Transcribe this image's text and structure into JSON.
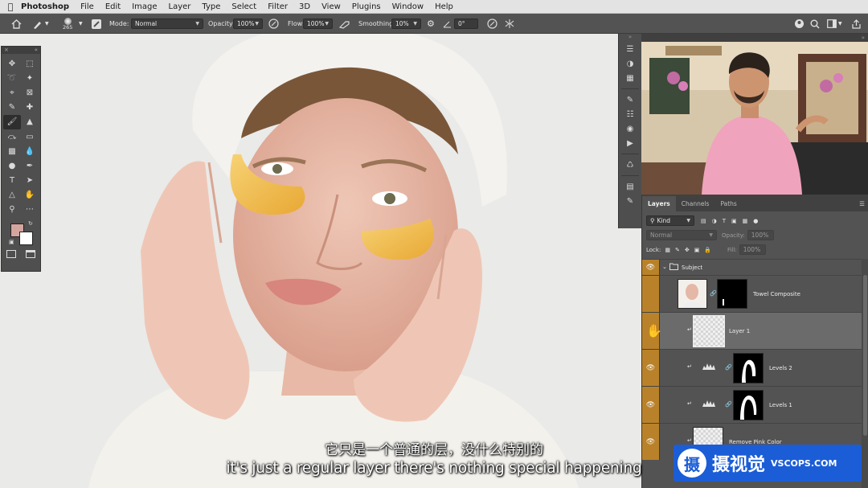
{
  "menubar": {
    "app_name": "Photoshop",
    "items": [
      "File",
      "Edit",
      "Image",
      "Layer",
      "Type",
      "Select",
      "Filter",
      "3D",
      "View",
      "Plugins",
      "Window",
      "Help"
    ]
  },
  "options_bar": {
    "brush_size": "265",
    "mode_label": "Mode:",
    "mode_value": "Normal",
    "opacity_label": "Opacity:",
    "opacity_value": "100%",
    "flow_label": "Flow:",
    "flow_value": "100%",
    "smoothing_label": "Smoothing:",
    "smoothing_value": "10%",
    "angle_value": "0°"
  },
  "colors": {
    "foreground_color": "#d4a59e",
    "background_color": "#ffffff",
    "eye_column": "#b9822a",
    "watermark_bg": "#1b5dd6"
  },
  "layers_panel": {
    "tabs": [
      "Layers",
      "Channels",
      "Paths"
    ],
    "active_tab": "Layers",
    "filter_kind": "Kind",
    "blend_mode": "Normal",
    "opacity_label": "Opacity:",
    "opacity_value": "100%",
    "lock_label": "Lock:",
    "fill_label": "Fill:",
    "fill_value": "100%",
    "group_name": "Subject",
    "layers": [
      {
        "name": "Towel Composite"
      },
      {
        "name": "Layer 1"
      },
      {
        "name": "Levels 2"
      },
      {
        "name": "Levels 1"
      },
      {
        "name": "Remove Pink Color"
      }
    ]
  },
  "subtitles": {
    "chinese": "它只是一个普通的层，没什么特别的",
    "english": "it's just a regular layer there's nothing special happening"
  },
  "watermark": {
    "logo_char": "摄",
    "chinese": "摄视觉",
    "english": "VSCOPS.COM"
  }
}
